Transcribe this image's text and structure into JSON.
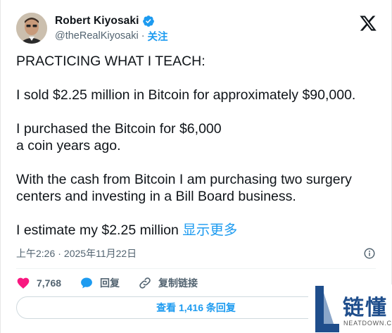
{
  "author": {
    "display_name": "Robert Kiyosaki",
    "handle": "@theRealKiyosaki",
    "separator": "·",
    "follow_label": "关注",
    "verified_color": "#1d9bf0"
  },
  "tweet": {
    "line1": "PRACTICING WHAT I TEACH:",
    "line2": "I sold $2.25 million in Bitcoin for approximately $90,000.",
    "line3a": "I purchased the Bitcoin for $6,000",
    "line3b": "a coin years ago.",
    "line4": "With the cash from Bitcoin I am purchasing two surgery centers and investing in a Bill Board business.",
    "line5": "I estimate my $2.25 million ",
    "show_more": "显示更多"
  },
  "meta": {
    "time": "上午2:26",
    "separator": "·",
    "date": "2025年11月22日"
  },
  "actions": {
    "likes": "7,768",
    "reply_label": "回复",
    "copy_link_label": "复制链接"
  },
  "replies_button": {
    "label": "查看 1,416 条回复"
  },
  "watermark": {
    "title": "链懂",
    "subtitle": "NEATDOWN.COM"
  },
  "colors": {
    "accent": "#1d9bf0",
    "like": "#f91880",
    "text": "#0f1419",
    "muted": "#536471"
  },
  "icons": [
    "verified-badge-icon",
    "x-logo-icon",
    "info-icon",
    "heart-icon",
    "reply-bubble-icon",
    "link-icon"
  ]
}
